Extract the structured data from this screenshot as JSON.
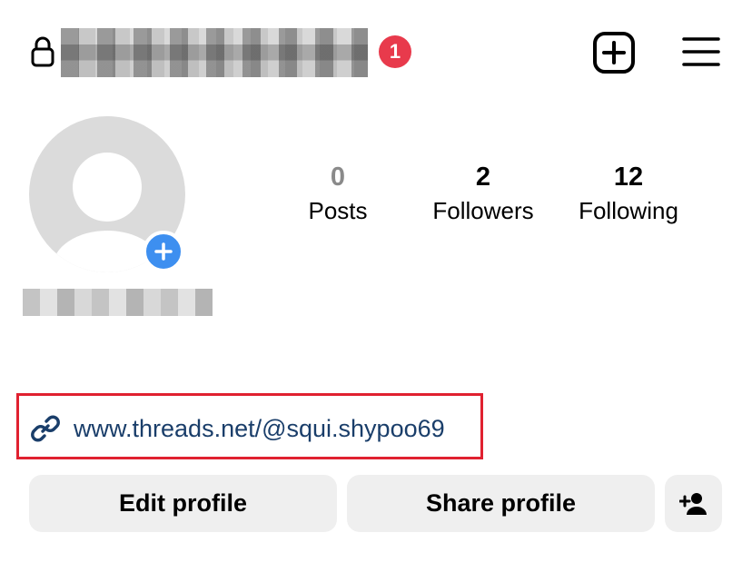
{
  "header": {
    "notification_count": "1",
    "icons": [
      "lock-icon",
      "plus-square-icon",
      "menu-icon"
    ]
  },
  "profile": {
    "stats": [
      {
        "value": "0",
        "label": "Posts"
      },
      {
        "value": "2",
        "label": "Followers"
      },
      {
        "value": "12",
        "label": "Following"
      }
    ],
    "link": "www.threads.net/@squi.shypoo69"
  },
  "actions": {
    "edit_label": "Edit profile",
    "share_label": "Share profile"
  },
  "colors": {
    "badge": "#e83a4c",
    "add_photo": "#3d8ff0",
    "link_text": "#1a3e6a",
    "highlight_border": "#e02130",
    "button_bg": "#efefef"
  }
}
